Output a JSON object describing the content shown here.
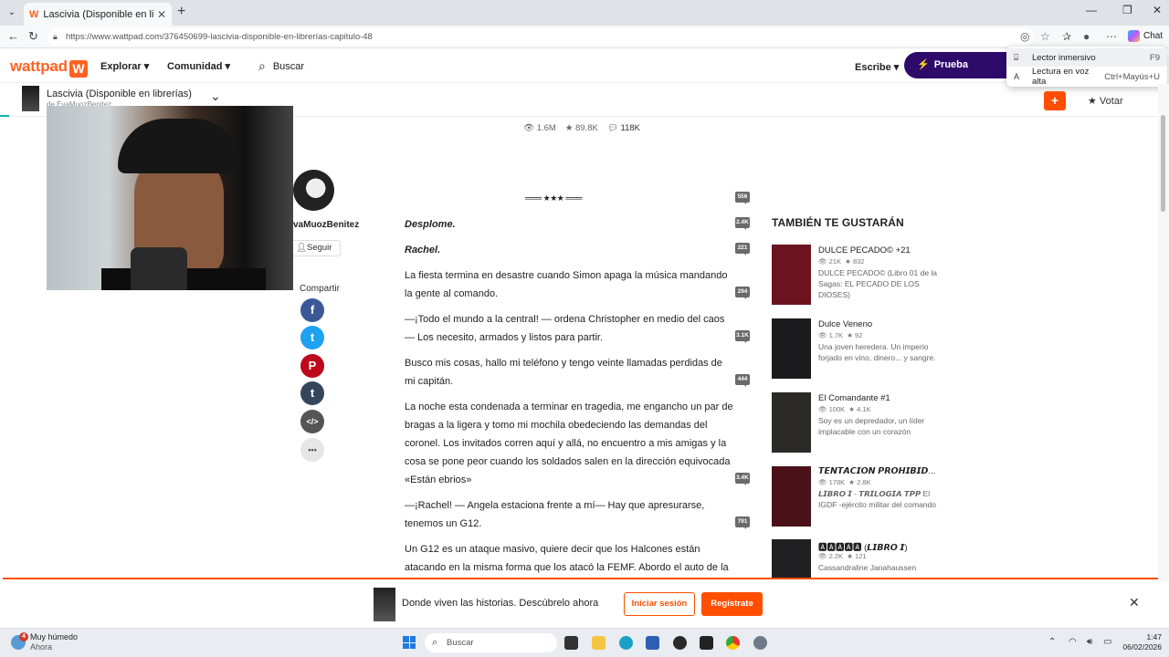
{
  "browser": {
    "tab_title": "Lascivia (Disponible en librerías) - ",
    "tab_favicon": "W",
    "url": "https://www.wattpad.com/376450699-lascivia-disponible-en-librerías-capitulo-48",
    "copilot_label": "Chat",
    "menu": [
      {
        "icon": "immersive-reader-icon",
        "glyph": "⌸",
        "label": "Lector inmersivo",
        "shortcut": "F9"
      },
      {
        "icon": "read-aloud-icon",
        "glyph": "A",
        "label": "Lectura en voz alta",
        "shortcut": "Ctrl+Mayús+U"
      }
    ]
  },
  "header": {
    "logo": "wattpad",
    "explore": "Explorar",
    "community": "Comunidad",
    "search": "Buscar",
    "write": "Escribe",
    "premium": "Prueba Premium"
  },
  "story": {
    "title": "Lascivia (Disponible en librerías)",
    "author_line": "de EvaMuozBenitez",
    "vote": "Votar",
    "add": "+"
  },
  "author": {
    "name": "vaMuozBenitez",
    "follow": "Seguir"
  },
  "share": {
    "label": "Compartir",
    "buttons": [
      {
        "name": "facebook-icon",
        "glyph": "f",
        "color": "#3b5998"
      },
      {
        "name": "twitter-icon",
        "glyph": "t",
        "color": "#1da1f2"
      },
      {
        "name": "pinterest-icon",
        "glyph": "P",
        "color": "#bd081c"
      },
      {
        "name": "tumblr-icon",
        "glyph": "t",
        "color": "#35465c"
      },
      {
        "name": "embed-icon",
        "glyph": "</>",
        "color": "#555555"
      },
      {
        "name": "more-icon",
        "glyph": "•••",
        "color": "#e6e6e6"
      }
    ]
  },
  "stats": {
    "reads": "1.6M",
    "votes": "89.8K",
    "comments": "118K"
  },
  "chapter": {
    "divider": "═══ ★★★ ═══",
    "paragraphs": [
      {
        "text": "Desplome.",
        "style": "bi",
        "comments": "2.4K"
      },
      {
        "text": "Rachel.",
        "style": "bi",
        "comments": "221"
      },
      {
        "text": "La fiesta termina en desastre cuando Simon apaga la música mandando la gente al comando.",
        "style": "",
        "comments": "294"
      },
      {
        "text": "—¡Todo el mundo a la central! — ordena Christopher en medio del caos — Los necesito, armados y listos para partir.",
        "style": "",
        "comments": "3.1K"
      },
      {
        "text": "Busco mis cosas, hallo mi teléfono y tengo veinte llamadas perdidas de mi capitán.",
        "style": "",
        "comments": "444"
      },
      {
        "text": "La noche esta condenada a terminar en tragedia, me engancho un par de bragas a la ligera y tomo mi mochila obedeciendo las demandas del coronel. Los invitados corren aquí y allá, no encuentro a mis amigas y la cosa se pone peor cuando los soldados salen en la dirección equivocada «Están ebrios»",
        "style": "",
        "comments": "3.4K"
      },
      {
        "text": "—¡Rachel! — Angela estaciona frente a mí— Hay que apresurarse, tenemos un G12.",
        "style": "",
        "comments": "791"
      },
      {
        "text": "Un G12 es un ataque masivo, quiere decir que los Halcones están atacando en la misma forma que los atacó la FEMF. Abordo el auto de la",
        "style": "",
        "comments": ""
      }
    ],
    "first_marker": "556"
  },
  "recommendations": {
    "title": "TAMBIÉN TE GUSTARÁN",
    "items": [
      {
        "name": "DULCE PECADO© +21",
        "reads": "21K",
        "votes": "832",
        "desc": "DULCE PECADO© (Libro 01 de la Sagas: EL PECADO DE LOS DIOSES)",
        "cover": "#6b1420"
      },
      {
        "name": "Dulce Veneno",
        "reads": "1.7K",
        "votes": "92",
        "desc": "Una joven heredera. Un imperio forjado en vino, dinero... y sangre.",
        "cover": "#1b1b1e"
      },
      {
        "name": "El Comandante #1",
        "reads": "100K",
        "votes": "4.1K",
        "desc": "Soy es un depredador, un líder implacable con un corazón",
        "cover": "#2b2a26"
      },
      {
        "name": "𝙏𝙀𝙉𝙏𝘼𝘾𝙄𝙊𝙉 𝙋𝙍𝙊𝙃𝙄𝘽𝙄𝘿...",
        "reads": "178K",
        "votes": "2.8K",
        "desc": "𝙇𝙄𝘽𝙍𝙊 𝙄 - 𝙏𝙍𝙄𝙇𝙊𝙂𝙄𝘼 𝙏𝙋𝙋 El IGDF -ejército militar del comando",
        "cover": "#4a1218"
      },
      {
        "name": "🅰🅰🅰🅰🅰 (𝙇𝙄𝘽𝙍𝙊 𝙄)",
        "reads": "2.2K",
        "votes": "121",
        "desc": "Cassandraline Janahaussen",
        "cover": "#202022"
      }
    ]
  },
  "banner": {
    "text": "Donde viven las historias. Descúbrelo ahora",
    "login": "Iniciar sesión",
    "register": "Regístrate"
  },
  "taskbar": {
    "weather_title": "Muy húmedo",
    "weather_sub": "Ahora",
    "weather_badge": "4",
    "search": "Buscar",
    "time": "1:47",
    "date": "06/02/2026"
  }
}
